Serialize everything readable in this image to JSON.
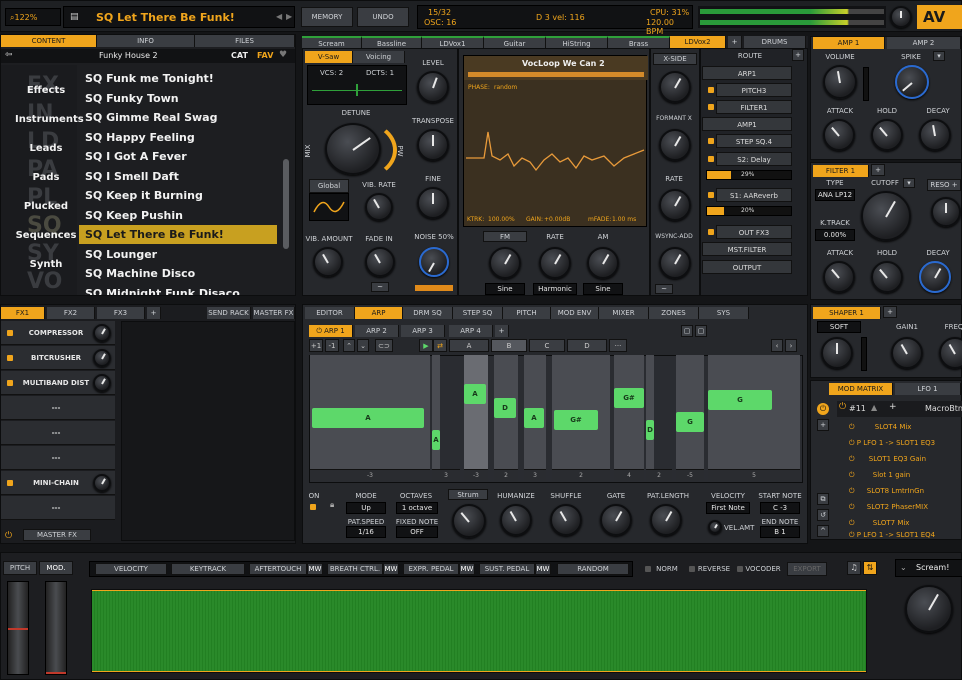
{
  "top": {
    "zoom": "122%",
    "preset_name": "SQ Let There Be Funk!",
    "memory": "MEMORY",
    "undo": "UNDO",
    "voices": "15/32",
    "osc": "OSC: 16",
    "note_info": "D 3 vel: 116",
    "cpu": "CPU: 31%",
    "bpm": "120.00 BPM",
    "logo": "AV"
  },
  "browser": {
    "tabs": [
      "CONTENT",
      "INFO",
      "FILES"
    ],
    "bank": "Funky House 2",
    "cat_label": "CAT",
    "fav_label": "FAV",
    "categories": [
      "Effects",
      "Instruments",
      "Leads",
      "Pads",
      "Plucked",
      "Sequences",
      "Synth"
    ],
    "big_letters": [
      "FX",
      "IN",
      "LD",
      "PA",
      "PL",
      "SQ",
      "SY",
      "VO"
    ],
    "presets": [
      "SQ Funk me Tonight!",
      "SQ Funky Town",
      "SQ Gimme Real Swag",
      "SQ Happy Feeling",
      "SQ I Got A Fever",
      "SQ I Smell Daft",
      "SQ Keep it Burning",
      "SQ Keep Pushin",
      "SQ Let There Be Funk!",
      "SQ Lounger",
      "SQ Machine Disco",
      "SQ Midnight Funk Disaco"
    ]
  },
  "slots": {
    "tabs": [
      "Scream",
      "Bassline",
      "LDVox1",
      "Guitar",
      "HiString",
      "Brass",
      "LDVox2"
    ],
    "drums": "DRUMS",
    "add": "+"
  },
  "osc": {
    "wave_tabs": [
      "V-Saw",
      "Voicing"
    ],
    "vcs": "VCS: 2",
    "dcts": "DCTS: 1",
    "detune": "DETUNE",
    "mix": "MIX",
    "pw": "PW",
    "level": "LEVEL",
    "transpose": "TRANSPOSE",
    "fine": "FINE",
    "noise": "NOISE 50%",
    "global": "Global",
    "vib_rate": "VIB. RATE",
    "vib_amount": "VIB. AMOUNT",
    "fade_in": "FADE IN"
  },
  "sample": {
    "title": "VocLoop We Can 2",
    "phase_label": "PHASE:",
    "phase_value": "random",
    "ktrk": "KTRK:",
    "ktrk_value": "100.00%",
    "gain": "GAIN:",
    "gain_value": "+0.00dB",
    "mfade": "mFADE:",
    "mfade_value": "1.00 ms",
    "fm": "FM",
    "rate": "RATE",
    "am": "AM",
    "sine1": "Sine",
    "harmonic": "Harmonic",
    "sine2": "Sine"
  },
  "xside": {
    "xside": "X-SIDE",
    "formant": "FORMANT X",
    "rate": "RATE",
    "wsync": "WSYNC-ADD"
  },
  "route": {
    "title": "ROUTE",
    "items": [
      "ARP1",
      "PITCH3",
      "FILTER1",
      "AMP1",
      "STEP SQ.4",
      "S2: Delay",
      "29%",
      "S1: AAReverb",
      "20%",
      "OUT FX3",
      "MST.FILTER",
      "OUTPUT"
    ]
  },
  "amp": {
    "tabs": [
      "AMP 1",
      "AMP 2"
    ],
    "volume": "VOLUME",
    "spike": "SPIKE",
    "attack": "ATTACK",
    "hold": "HOLD",
    "decay": "DECAY"
  },
  "filter": {
    "tab": "FILTER 1",
    "type": "TYPE",
    "type_value": "ANA LP12",
    "cutoff": "CUTOFF",
    "reso": "RESO +",
    "ktrack": "K.TRACK",
    "ktrack_value": "0.00%",
    "attack": "ATTACK",
    "hold": "HOLD",
    "decay": "DECAY"
  },
  "shaper": {
    "tab": "SHAPER 1",
    "soft": "SOFT",
    "gain1": "GAIN1",
    "freq": "FREQ"
  },
  "modmatrix": {
    "tab": "MOD MATRIX",
    "lfo": "LFO 1",
    "slot": "#11",
    "macro": "MacroBtn",
    "rows": [
      "SLOT4 Mix",
      "P LFO 1 -> SLOT1 EQ3",
      "SLOT1 EQ3 Gain",
      "Slot 1 gain",
      "SLOT8 LmtrInGn",
      "SLOT2 PhaserMIX",
      "SLOT7 Mix",
      "P LFO 1 -> SLOT1 EQ4"
    ]
  },
  "fx": {
    "tabs": [
      "FX1",
      "FX2",
      "FX3"
    ],
    "send_rack": "SEND RACK",
    "master_fx": "MASTER FX",
    "items": [
      "COMPRESSOR",
      "BITCRUSHER",
      "MULTIBAND DIST",
      "---",
      "---",
      "---",
      "MINI-CHAIN",
      "---"
    ],
    "master_label": "MASTER FX"
  },
  "editor": {
    "tabs": [
      "EDITOR",
      "ARP",
      "DRM SQ",
      "STEP SQ",
      "PITCH",
      "MOD ENV",
      "MIXER",
      "ZONES",
      "SYS"
    ],
    "arp_tabs": [
      "ARP 1",
      "ARP 2",
      "ARP 3",
      "ARP 4"
    ],
    "pattern_tabs": [
      "A",
      "B",
      "C",
      "D",
      "···"
    ],
    "prefix1": "+1",
    "prefix2": "-1",
    "columns": [
      {
        "note": "A",
        "value": "-3"
      },
      {
        "note": "A",
        "value": "3"
      },
      {
        "note": "A",
        "value": "-3"
      },
      {
        "note": "D",
        "value": "2"
      },
      {
        "note": "A",
        "value": "3"
      },
      {
        "note": "G#",
        "value": "2"
      },
      {
        "note": "G#",
        "value": "4"
      },
      {
        "note": "D",
        "value": "2"
      },
      {
        "note": "G",
        "value": "-5"
      },
      {
        "note": "G",
        "value": "5"
      }
    ],
    "on": "ON",
    "mode": "MODE",
    "mode_value": "Up",
    "octaves": "OCTAVES",
    "octaves_value": "1 octave",
    "strum": "Strum",
    "humanize": "HUMANIZE",
    "shuffle": "SHUFFLE",
    "gate": "GATE",
    "pat_length": "PAT.LENGTH",
    "velocity": "VELOCITY",
    "velocity_value": "First Note",
    "start_note": "START NOTE",
    "start_value": "C -3",
    "pat_speed": "PAT.SPEED",
    "pat_speed_value": "1/16",
    "fixed_note": "FIXED NOTE",
    "fixed_value": "OFF",
    "vel_amt": "VEL.AMT",
    "end_note": "END NOTE",
    "end_value": "B 1"
  },
  "bottom": {
    "pitch": "PITCH",
    "mod": "MOD.",
    "sources": [
      "VELOCITY",
      "KEYTRACK",
      "AFTERTOUCH",
      "BREATH CTRL.",
      "EXPR. PEDAL",
      "SUST. PEDAL",
      "RANDOM"
    ],
    "mw": "MW",
    "norm": "NORM",
    "reverse": "REVERSE",
    "vocoder": "VOCODER",
    "export": "EXPORT",
    "scream": "Scream!"
  }
}
